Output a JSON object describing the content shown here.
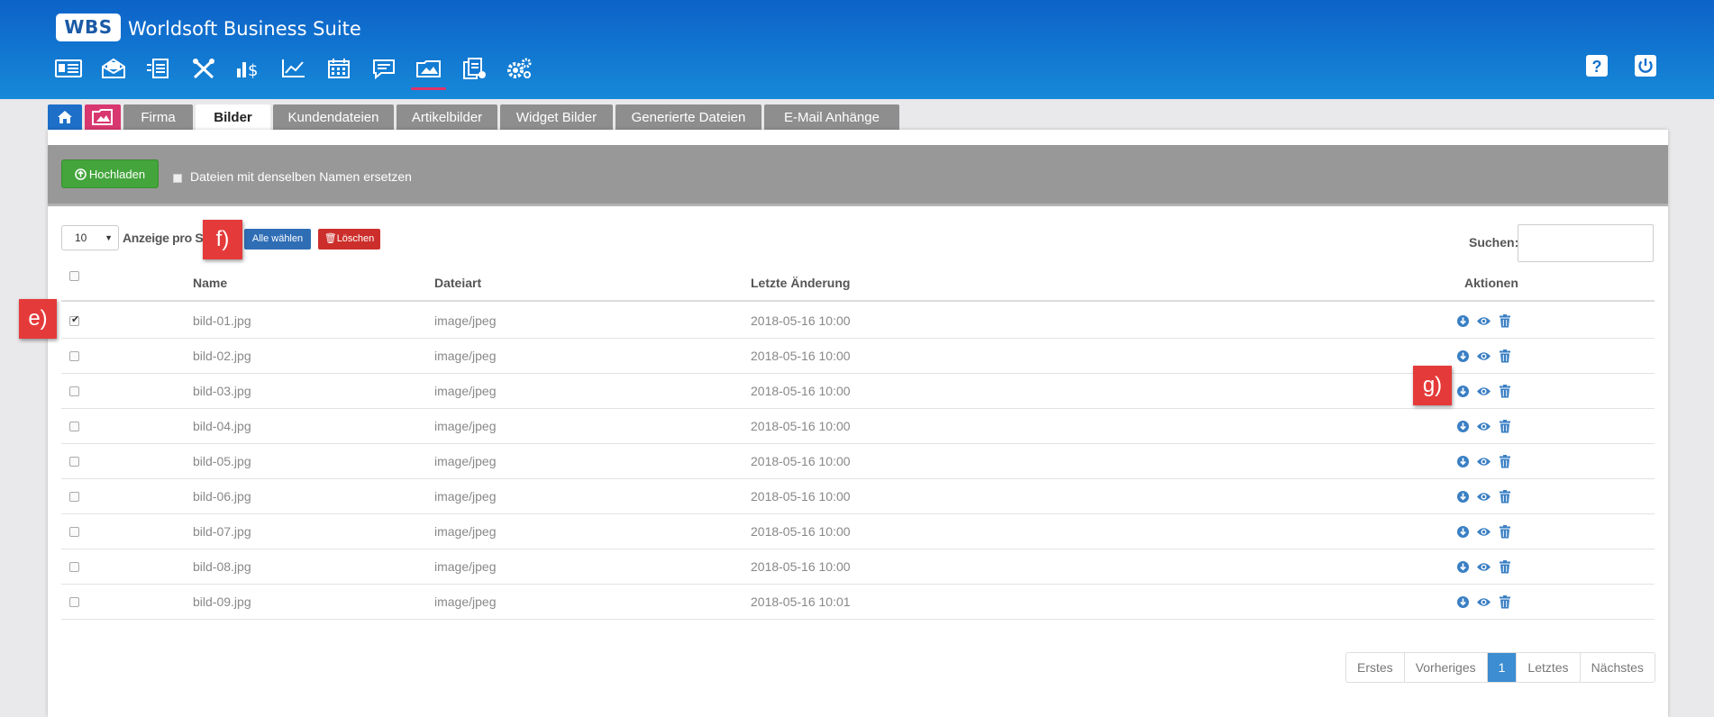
{
  "header": {
    "logo": "WBS",
    "title": "Worldsoft Business Suite",
    "nav_icons": [
      "contact-card-icon",
      "mail-icon",
      "document-exchange-icon",
      "tools-icon",
      "finance-icon",
      "chart-icon",
      "calendar-icon",
      "chat-icon",
      "images-folder-icon",
      "document-stack-icon",
      "settings-icon"
    ],
    "active_nav": "images-folder-icon"
  },
  "tabs": [
    "Firma",
    "Bilder",
    "Kundendateien",
    "Artikelbilder",
    "Widget Bilder",
    "Generierte Dateien",
    "E-Mail Anhänge"
  ],
  "active_tab": "Bilder",
  "toolbar": {
    "upload_label": "Hochladen",
    "replace_label": "Dateien mit denselben Namen ersetzen"
  },
  "controls": {
    "per_page_value": "10",
    "per_page_label": "Anzeige pro Se",
    "select_all_label": "Alle wählen",
    "delete_label": "Löschen",
    "search_label": "Suchen:"
  },
  "table": {
    "columns": [
      "Name",
      "Dateiart",
      "Letzte Änderung",
      "Aktionen"
    ],
    "rows": [
      {
        "name": "bild-01.jpg",
        "type": "image/jpeg",
        "date": "2018-05-16 10:00",
        "checked": true
      },
      {
        "name": "bild-02.jpg",
        "type": "image/jpeg",
        "date": "2018-05-16 10:00",
        "checked": false
      },
      {
        "name": "bild-03.jpg",
        "type": "image/jpeg",
        "date": "2018-05-16 10:00",
        "checked": false
      },
      {
        "name": "bild-04.jpg",
        "type": "image/jpeg",
        "date": "2018-05-16 10:00",
        "checked": false
      },
      {
        "name": "bild-05.jpg",
        "type": "image/jpeg",
        "date": "2018-05-16 10:00",
        "checked": false
      },
      {
        "name": "bild-06.jpg",
        "type": "image/jpeg",
        "date": "2018-05-16 10:00",
        "checked": false
      },
      {
        "name": "bild-07.jpg",
        "type": "image/jpeg",
        "date": "2018-05-16 10:00",
        "checked": false
      },
      {
        "name": "bild-08.jpg",
        "type": "image/jpeg",
        "date": "2018-05-16 10:00",
        "checked": false
      },
      {
        "name": "bild-09.jpg",
        "type": "image/jpeg",
        "date": "2018-05-16 10:01",
        "checked": false
      }
    ]
  },
  "pagination": [
    "Erstes",
    "Vorheriges",
    "1",
    "Letztes",
    "Nächstes"
  ],
  "active_page": "1",
  "markers": {
    "e": "e)",
    "f": "f)",
    "g": "g)"
  },
  "colors": {
    "header": "#1377d2",
    "upload": "#43a53b",
    "select_all": "#2f6eb5",
    "delete": "#cc2f2b",
    "marker": "#e53a3a"
  }
}
